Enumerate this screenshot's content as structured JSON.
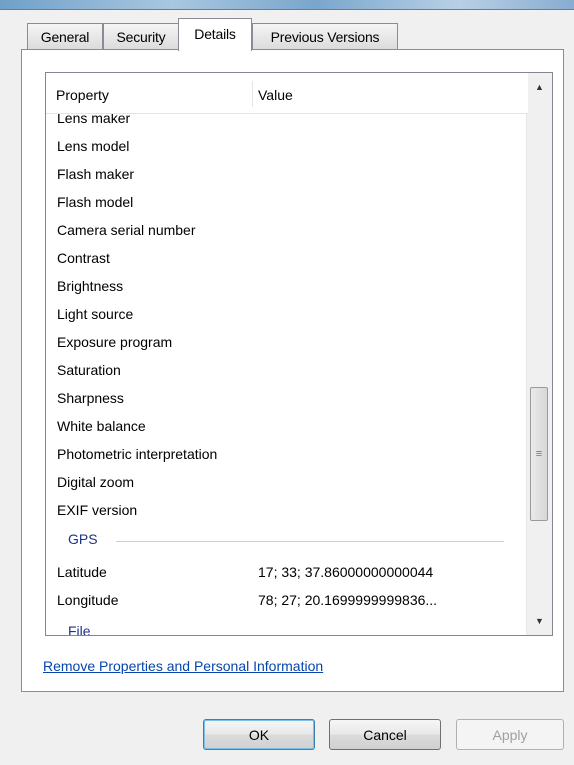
{
  "tabs": [
    {
      "label": "General"
    },
    {
      "label": "Security"
    },
    {
      "label": "Details"
    },
    {
      "label": "Previous Versions"
    }
  ],
  "list": {
    "columns": {
      "property": "Property",
      "value": "Value"
    },
    "partial_top_row": "Lens maker",
    "rows": [
      {
        "name": "Lens model",
        "value": ""
      },
      {
        "name": "Flash maker",
        "value": ""
      },
      {
        "name": "Flash model",
        "value": ""
      },
      {
        "name": "Camera serial number",
        "value": ""
      },
      {
        "name": "Contrast",
        "value": ""
      },
      {
        "name": "Brightness",
        "value": ""
      },
      {
        "name": "Light source",
        "value": ""
      },
      {
        "name": "Exposure program",
        "value": ""
      },
      {
        "name": "Saturation",
        "value": ""
      },
      {
        "name": "Sharpness",
        "value": ""
      },
      {
        "name": "White balance",
        "value": ""
      },
      {
        "name": "Photometric interpretation",
        "value": ""
      },
      {
        "name": "Digital zoom",
        "value": ""
      },
      {
        "name": "EXIF version",
        "value": ""
      }
    ],
    "gps_group": "GPS",
    "gps_rows": [
      {
        "name": "Latitude",
        "value": "17; 33; 37.86000000000044"
      },
      {
        "name": "Longitude",
        "value": "78; 27; 20.1699999999836..."
      }
    ],
    "next_group_partial": "File"
  },
  "link_text": "Remove Properties and Personal Information",
  "buttons": {
    "ok": "OK",
    "cancel": "Cancel",
    "apply": "Apply"
  },
  "colors": {
    "group_header": "#1e3287",
    "link": "#0645ad"
  },
  "icons": {
    "scroll_up": "up-arrow-icon",
    "scroll_down": "down-arrow-icon",
    "grip": "scroll-grip-icon"
  }
}
